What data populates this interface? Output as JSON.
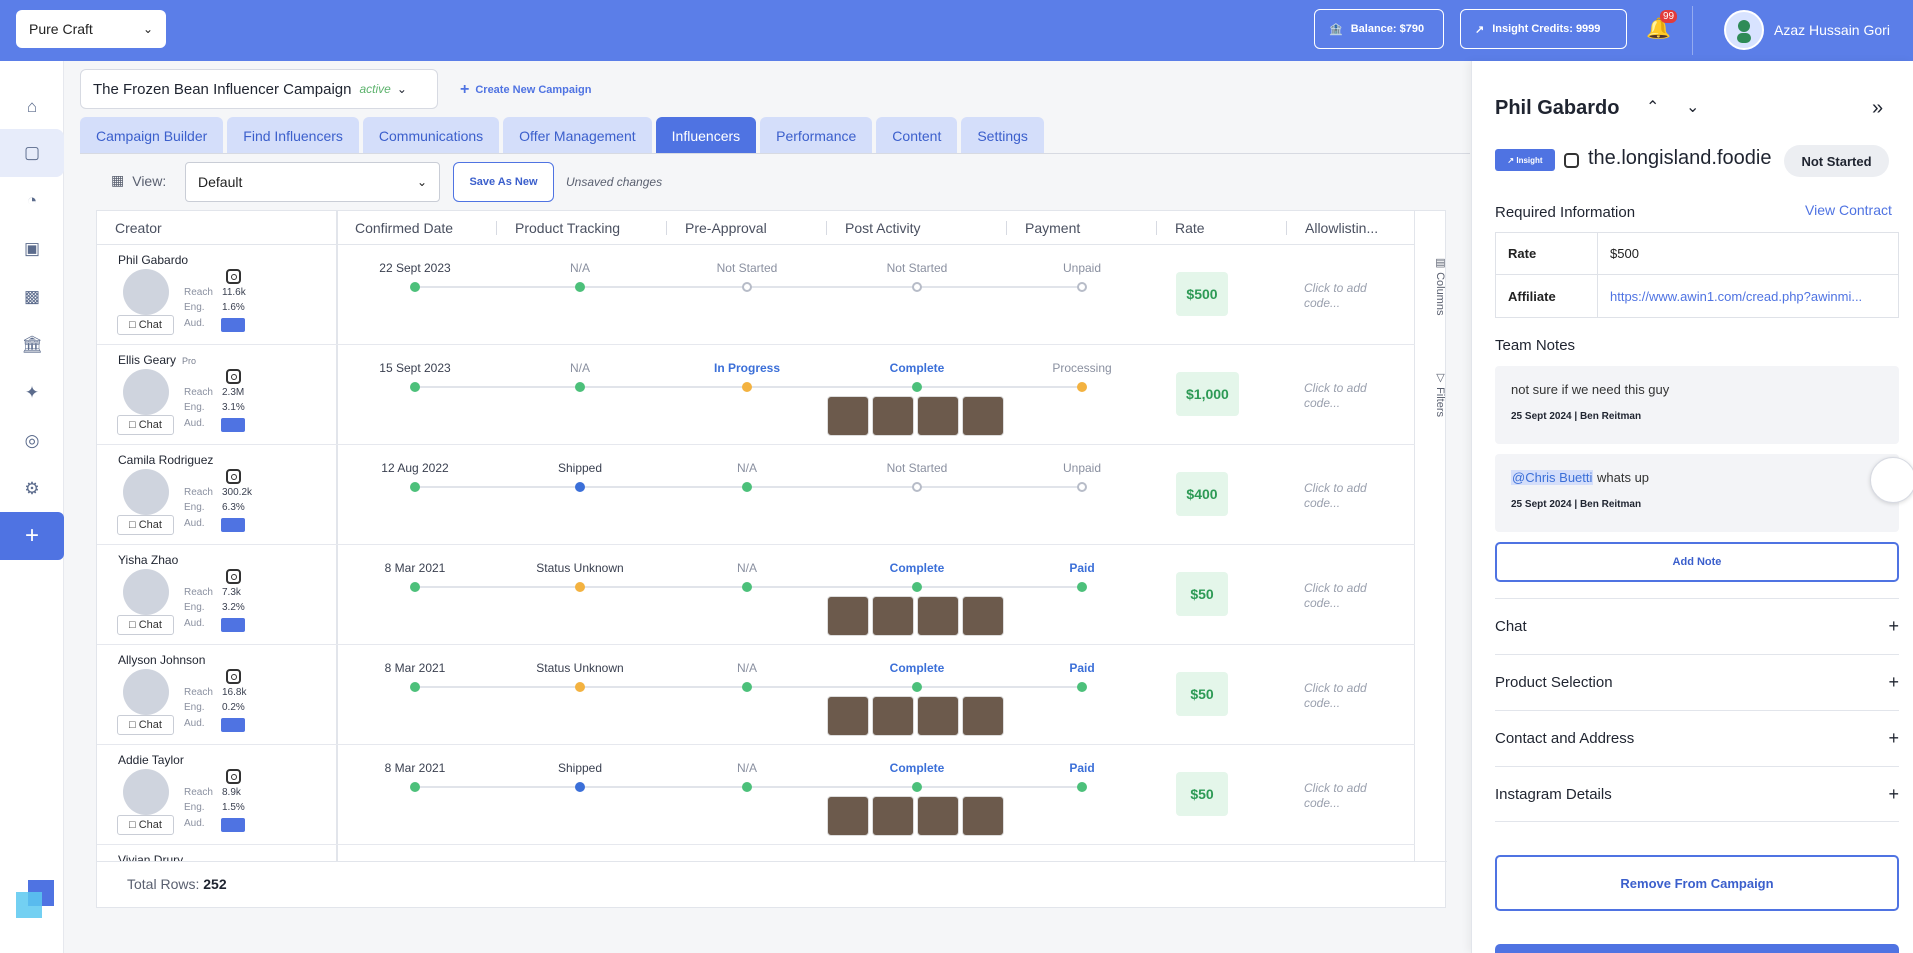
{
  "topbar": {
    "brand": "Pure Craft",
    "balance": "Balance: $790",
    "insight_credits": "Insight Credits: 9999",
    "notifications_count": "99",
    "user_name": "Azaz Hussain Gori"
  },
  "rail": {
    "items": [
      "home-icon",
      "campaigns-icon",
      "analytics-icon",
      "media-icon",
      "messages-icon",
      "bank-icon",
      "ai-icon",
      "target-icon",
      "settings-icon"
    ],
    "add_icon": "plus-icon"
  },
  "campaign": {
    "name": "The Frozen Bean Influencer Campaign",
    "status": "active",
    "create_label": "Create New Campaign"
  },
  "tabs": [
    {
      "label": "Campaign Builder"
    },
    {
      "label": "Find Influencers"
    },
    {
      "label": "Communications"
    },
    {
      "label": "Offer Management"
    },
    {
      "label": "Influencers"
    },
    {
      "label": "Performance"
    },
    {
      "label": "Content"
    },
    {
      "label": "Settings"
    }
  ],
  "active_tab": "Influencers",
  "view": {
    "label": "View:",
    "selected": "Default",
    "save_as_new": "Save As New",
    "unsaved": "Unsaved changes"
  },
  "table": {
    "headers": {
      "creator": "Creator",
      "confirmed_date": "Confirmed Date",
      "product_tracking": "Product Tracking",
      "pre_approval": "Pre-Approval",
      "post_activity": "Post Activity",
      "payment": "Payment",
      "rate": "Rate",
      "allowlisting": "Allowlistin..."
    },
    "metric_labels": {
      "reach": "Reach",
      "eng": "Eng.",
      "aud": "Aud."
    },
    "chat_label": "Chat",
    "allow_placeholder_1": "Click to add",
    "allow_placeholder_2": "code...",
    "side_columns": "Columns",
    "side_filters": "Filters",
    "rows": [
      {
        "name": "Phil Gabardo",
        "pro": "",
        "reach": "11.6k",
        "eng": "1.6%",
        "date": "22 Sept 2023",
        "tracking": "N/A",
        "preapproval": "Not Started",
        "post": "Not Started",
        "payment": "Unpaid",
        "rate": "$500"
      },
      {
        "name": "Ellis Geary",
        "pro": "Pro",
        "reach": "2.3M",
        "eng": "3.1%",
        "date": "15 Sept 2023",
        "tracking": "N/A",
        "preapproval": "In Progress",
        "post": "Complete",
        "payment": "Processing",
        "rate": "$1,000"
      },
      {
        "name": "Camila Rodriguez",
        "pro": "",
        "reach": "300.2k",
        "eng": "6.3%",
        "date": "12 Aug 2022",
        "tracking": "Shipped",
        "preapproval": "N/A",
        "post": "Not Started",
        "payment": "Unpaid",
        "rate": "$400"
      },
      {
        "name": "Yisha Zhao",
        "pro": "",
        "reach": "7.3k",
        "eng": "3.2%",
        "date": "8 Mar 2021",
        "tracking": "Status Unknown",
        "preapproval": "N/A",
        "post": "Complete",
        "payment": "Paid",
        "rate": "$50"
      },
      {
        "name": "Allyson Johnson",
        "pro": "",
        "reach": "16.8k",
        "eng": "0.2%",
        "date": "8 Mar 2021",
        "tracking": "Status Unknown",
        "preapproval": "N/A",
        "post": "Complete",
        "payment": "Paid",
        "rate": "$50"
      },
      {
        "name": "Addie Taylor",
        "pro": "",
        "reach": "8.9k",
        "eng": "1.5%",
        "date": "8 Mar 2021",
        "tracking": "Shipped",
        "preapproval": "N/A",
        "post": "Complete",
        "payment": "Paid",
        "rate": "$50"
      },
      {
        "name": "Vivian Drury",
        "pro": "",
        "reach": "",
        "eng": "",
        "date": "",
        "tracking": "",
        "preapproval": "",
        "post": "",
        "payment": "",
        "rate": ""
      }
    ],
    "total_rows_label": "Total Rows:",
    "total_rows": "252"
  },
  "panel": {
    "name": "Phil Gabardo",
    "insight": "Insight",
    "handle": "the.longisland.foodie",
    "status": "Not Started",
    "required_info": "Required Information",
    "view_contract": "View Contract",
    "rate_label": "Rate",
    "rate_value": "$500",
    "affiliate_label": "Affiliate",
    "affiliate_value": "https://www.awin1.com/cread.php?awinmi...",
    "team_notes": "Team Notes",
    "notes": [
      {
        "text": "not sure if we need this guy",
        "meta": "25 Sept 2024 | Ben Reitman"
      },
      {
        "mention": "@Chris Buetti",
        "text": " whats up",
        "meta": "25 Sept 2024 | Ben Reitman"
      }
    ],
    "add_note": "Add Note",
    "sections": [
      "Chat",
      "Product Selection",
      "Contact and Address",
      "Instagram Details"
    ],
    "remove": "Remove From Campaign"
  }
}
